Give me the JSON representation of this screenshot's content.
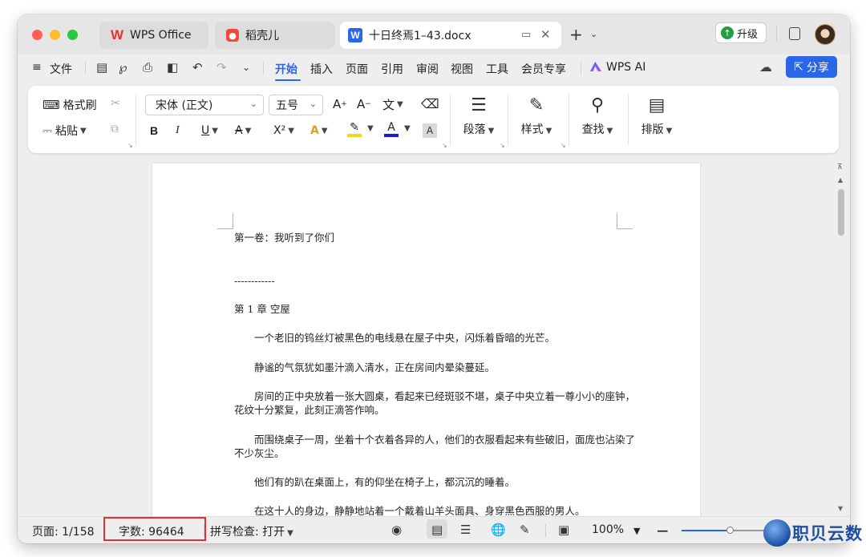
{
  "titlebar": {
    "tabs": [
      {
        "label": "WPS Office",
        "logo": "W"
      },
      {
        "label": "稻壳儿"
      },
      {
        "label": "十日终焉1–43.docx",
        "logo": "W"
      }
    ],
    "new_tab_icon": "+",
    "upgrade_label": "升级",
    "colors": {
      "accent": "#2b65e8",
      "wps_red": "#e8322b",
      "upgrade_green": "#1e9e3e"
    }
  },
  "menubar": {
    "file_label": "文件",
    "tabs": [
      "开始",
      "插入",
      "页面",
      "引用",
      "审阅",
      "视图",
      "工具",
      "会员专享"
    ],
    "ai_label": "WPS AI",
    "share_label": "分享"
  },
  "ribbon": {
    "format_painter": "格式刷",
    "paste": "粘贴",
    "font_name": "宋体 (正文)",
    "font_size": "五号",
    "bold": "B",
    "italic": "I",
    "underline": "U",
    "strike": "A",
    "superscript": "X²",
    "shading_letter": "A",
    "paragraph": "段落",
    "styles": "样式",
    "find": "查找",
    "layout": "排版"
  },
  "document": {
    "lines": [
      "第一卷：我听到了你们",
      "------------",
      "第 1 章 空屋",
      "一个老旧的钨丝灯被黑色的电线悬在屋子中央，闪烁着昏暗的光芒。",
      "静谧的气氛犹如墨汁滴入清水，正在房间内晕染蔓延。",
      "房间的正中央放着一张大圆桌，看起来已经斑驳不堪，桌子中央立着一尊小小的座钟，",
      "花纹十分繁复，此刻正滴答作响。",
      "而围绕桌子一周，坐着十个衣着各异的人，他们的衣服看起来有些破旧，面庞也沾染了",
      "不少灰尘。",
      "他们有的趴在桌面上，有的仰坐在椅子上，都沉沉的睡着。",
      "在这十人的身边，静静地站着一个戴着山羊头面具、身穿黑色西服的男人。"
    ]
  },
  "statusbar": {
    "page": "页面: 1/158",
    "word_count": "字数: 96464",
    "spellcheck": "拼写检查: 打开",
    "zoom": "100%"
  },
  "watermark": {
    "text": "职贝云数"
  }
}
